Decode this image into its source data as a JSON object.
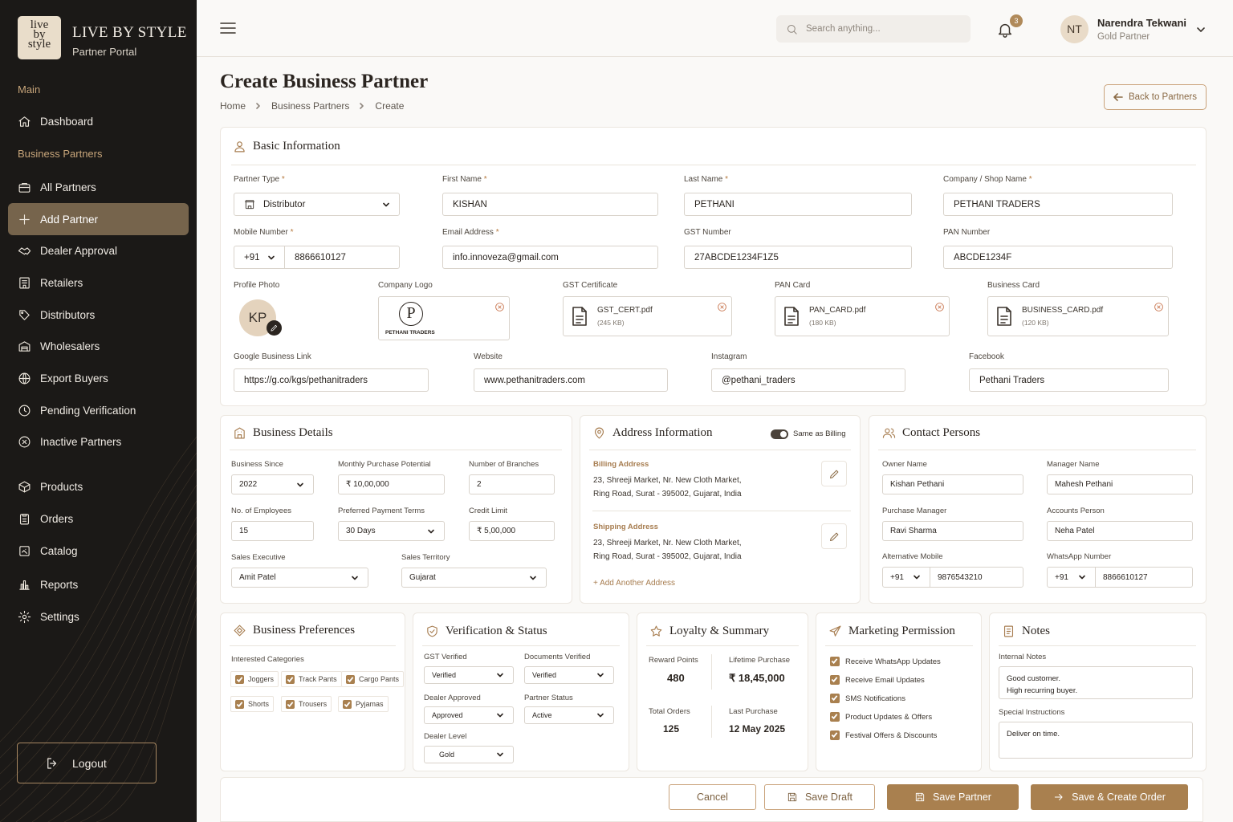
{
  "brand": {
    "logo_line1": "live",
    "logo_line2": "by",
    "logo_line3": "style",
    "name": "LIVE BY STYLE",
    "subtitle": "Partner Portal"
  },
  "sidebar": {
    "section_main": "Main",
    "section_partners": "Business Partners",
    "items": [
      {
        "label": "Dashboard",
        "icon": "home-icon"
      },
      {
        "label": "All Partners",
        "icon": "briefcase-icon"
      },
      {
        "label": "Add Partner",
        "icon": "plus-icon"
      },
      {
        "label": "Dealer Approval",
        "icon": "handshake-icon"
      },
      {
        "label": "Retailers",
        "icon": "store-icon"
      },
      {
        "label": "Distributors",
        "icon": "truck-icon"
      },
      {
        "label": "Wholesalers",
        "icon": "warehouse-icon"
      },
      {
        "label": "Export Buyers",
        "icon": "globe-icon"
      },
      {
        "label": "Pending Verification",
        "icon": "pending-icon"
      },
      {
        "label": "Inactive Partners",
        "icon": "x-circle-icon"
      },
      {
        "label": "Products",
        "icon": "tag-icon"
      },
      {
        "label": "Orders",
        "icon": "clipboard-icon"
      },
      {
        "label": "Catalog",
        "icon": "catalog-icon"
      },
      {
        "label": "Reports",
        "icon": "bar-chart-icon"
      },
      {
        "label": "Settings",
        "icon": "gear-icon"
      }
    ],
    "logout": "Logout"
  },
  "topbar": {
    "search_placeholder": "Search anything...",
    "notif_count": "3",
    "avatar_initials": "NT",
    "user_name": "Narendra Tekwani",
    "user_role": "Gold Partner"
  },
  "page": {
    "title": "Create Business Partner",
    "breadcrumb": [
      "Home",
      "Business Partners",
      "Create"
    ],
    "back_button": "Back to Partners"
  },
  "basic": {
    "title": "Basic Information",
    "partner_type_label": "Partner Type",
    "partner_type": "Distributor",
    "first_name_label": "First Name",
    "first_name": "KISHAN",
    "last_name_label": "Last Name",
    "last_name": "PETHANI",
    "company_label": "Company / Shop Name",
    "company": "PETHANI TRADERS",
    "mobile_label": "Mobile Number",
    "mobile_code": "+91",
    "mobile": "8866610127",
    "email_label": "Email Address",
    "email": "info.innoveza@gmail.com",
    "gst_label": "GST Number",
    "gst": "27ABCDE1234F1Z5",
    "pan_label": "PAN Number",
    "pan": "ABCDE1234F",
    "photo_label": "Profile Photo",
    "photo_initials": "KP",
    "logo_label": "Company Logo",
    "logo_letter": "P",
    "logo_text": "PETHANI TRADERS",
    "gst_cert_label": "GST Certificate",
    "gst_cert_file": "GST_CERT.pdf",
    "gst_cert_size": "(245 KB)",
    "pan_card_label": "PAN Card",
    "pan_card_file": "PAN_CARD.pdf",
    "pan_card_size": "(180 KB)",
    "biz_card_label": "Business Card",
    "biz_card_file": "BUSINESS_CARD.pdf",
    "biz_card_size": "(120 KB)",
    "google_label": "Google Business Link",
    "google": "https://g.co/kgs/pethanitraders",
    "website_label": "Website",
    "website": "www.pethanitraders.com",
    "instagram_label": "Instagram",
    "instagram": "@pethani_traders",
    "facebook_label": "Facebook",
    "facebook": "Pethani Traders"
  },
  "business": {
    "title": "Business Details",
    "since_label": "Business Since",
    "since": "2022",
    "potential_label": "Monthly Purchase Potential",
    "potential": "₹ 10,00,000",
    "branches_label": "Number of Branches",
    "branches": "2",
    "employees_label": "No. of Employees",
    "employees": "15",
    "terms_label": "Preferred Payment Terms",
    "terms": "30 Days",
    "credit_label": "Credit Limit",
    "credit": "₹ 5,00,000",
    "exec_label": "Sales Executive",
    "exec": "Amit Patel",
    "territory_label": "Sales Territory",
    "territory": "Gujarat"
  },
  "address": {
    "title": "Address Information",
    "same_label": "Same as Billing",
    "billing_title": "Billing Address",
    "billing_line1": "23, Shreeji Market, Nr. New Cloth Market,",
    "billing_line2": "Ring Road, Surat - 395002, Gujarat, India",
    "shipping_title": "Shipping Address",
    "shipping_line1": "23, Shreeji Market, Nr. New Cloth Market,",
    "shipping_line2": "Ring Road, Surat - 395002, Gujarat, India",
    "add_another": "+ Add Another Address"
  },
  "contacts": {
    "title": "Contact Persons",
    "owner_label": "Owner Name",
    "owner": "Kishan Pethani",
    "manager_label": "Manager Name",
    "manager": "Mahesh Pethani",
    "purchase_label": "Purchase Manager",
    "purchase": "Ravi Sharma",
    "accounts_label": "Accounts Person",
    "accounts": "Neha Patel",
    "alt_label": "Alternative Mobile",
    "alt_code": "+91",
    "alt": "9876543210",
    "wa_label": "WhatsApp Number",
    "wa_code": "+91",
    "wa": "8866610127"
  },
  "prefs": {
    "title": "Business Preferences",
    "categories_label": "Interested Categories",
    "categories": [
      "Joggers",
      "Track Pants",
      "Cargo Pants",
      "Shorts",
      "Trousers",
      "Pyjamas"
    ]
  },
  "verification": {
    "title": "Verification & Status",
    "gst_label": "GST Verified",
    "gst": "Verified",
    "docs_label": "Documents Verified",
    "docs": "Verified",
    "dealer_label": "Dealer Approved",
    "dealer": "Approved",
    "status_label": "Partner Status",
    "status": "Active",
    "level_label": "Dealer Level",
    "level": "Gold"
  },
  "loyalty": {
    "title": "Loyalty & Summary",
    "points_label": "Reward Points",
    "points": "480",
    "lifetime_label": "Lifetime Purchase",
    "lifetime": "₹ 18,45,000",
    "orders_label": "Total Orders",
    "orders": "125",
    "last_label": "Last Purchase",
    "last": "12 May 2025"
  },
  "marketing": {
    "title": "Marketing Permission",
    "items": [
      "Receive WhatsApp Updates",
      "Receive Email Updates",
      "SMS Notifications",
      "Product Updates & Offers",
      "Festival Offers & Discounts"
    ]
  },
  "notes": {
    "title": "Notes",
    "internal_label": "Internal Notes",
    "internal_line1": "Good customer.",
    "internal_line2": "High recurring buyer.",
    "special_label": "Special Instructions",
    "special": "Deliver on time."
  },
  "actions": {
    "cancel": "Cancel",
    "draft": "Save Draft",
    "save": "Save Partner",
    "save_order": "Save & Create Order"
  },
  "colors": {
    "accent": "#a9804f",
    "sidebar_bg": "#1b1917",
    "active_nav": "#76644c"
  }
}
